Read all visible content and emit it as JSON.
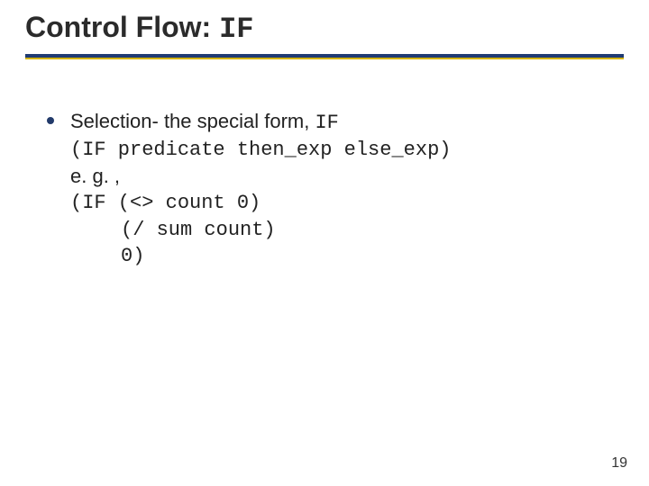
{
  "title": {
    "prefix": "Control Flow: ",
    "code": "IF"
  },
  "bullet": {
    "lead_text": "Selection- the special form, ",
    "lead_code": "IF",
    "code_line_1": "(IF predicate then_exp else_exp)",
    "eg": "e. g. ,",
    "code_line_2": "(IF (<> count 0)",
    "code_line_3": "(/ sum count)",
    "code_line_4": "0)"
  },
  "page_number": "19"
}
